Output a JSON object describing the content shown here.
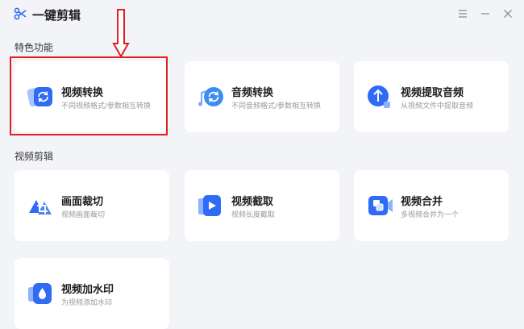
{
  "window": {
    "title": "一键剪辑"
  },
  "sections": {
    "featured": "特色功能",
    "video_edit": "视频剪辑"
  },
  "cards": {
    "video_convert": {
      "title": "视频转换",
      "desc": "不同视频格式/参数相互转换"
    },
    "audio_convert": {
      "title": "音频转换",
      "desc": "不同音频格式/参数相互转换"
    },
    "extract_audio": {
      "title": "视频提取音频",
      "desc": "从视频文件中提取音频"
    },
    "crop": {
      "title": "画面裁切",
      "desc": "视频画面裁切"
    },
    "trim": {
      "title": "视频截取",
      "desc": "视频长度截取"
    },
    "merge": {
      "title": "视频合并",
      "desc": "多视频合并为一个"
    },
    "watermark": {
      "title": "视频加水印",
      "desc": "为视频添加水印"
    }
  },
  "colors": {
    "accent": "#2f6bf5",
    "highlight": "#e02020"
  },
  "icons": [
    "scissors-icon",
    "menu-icon",
    "minimize-icon",
    "close-icon",
    "refresh-icon",
    "upload-icon",
    "crop-icon",
    "play-icon",
    "merge-icon",
    "droplet-icon",
    "down-arrow-icon"
  ]
}
